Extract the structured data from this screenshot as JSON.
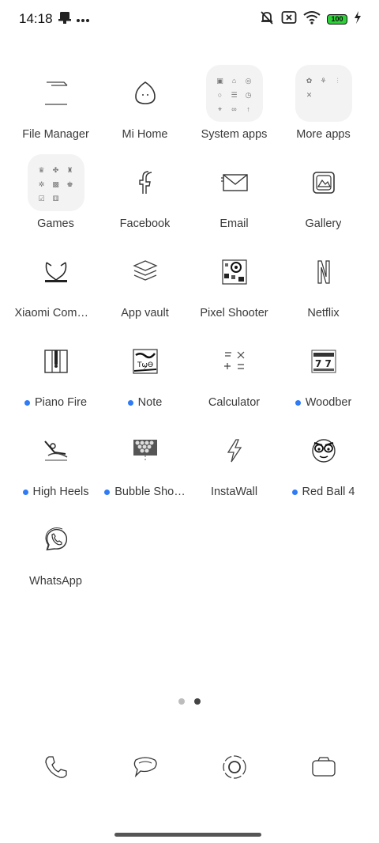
{
  "status_bar": {
    "time": "14:18",
    "battery": "100",
    "left_icons": [
      "notification-icon",
      "more-dots-icon"
    ],
    "right_icons": [
      "mute-icon",
      "no-sim-icon",
      "wifi-icon",
      "battery-icon",
      "charging-icon"
    ]
  },
  "apps": [
    {
      "label": "File Manager",
      "icon": "file-manager-icon",
      "new": false
    },
    {
      "label": "Mi Home",
      "icon": "mi-home-icon",
      "new": false
    },
    {
      "label": "System apps",
      "icon": "folder-icon",
      "new": false
    },
    {
      "label": "More apps",
      "icon": "folder-icon",
      "new": false
    },
    {
      "label": "Games",
      "icon": "folder-icon",
      "new": false
    },
    {
      "label": "Facebook",
      "icon": "facebook-icon",
      "new": false
    },
    {
      "label": "Email",
      "icon": "email-icon",
      "new": false
    },
    {
      "label": "Gallery",
      "icon": "gallery-icon",
      "new": false
    },
    {
      "label": "Xiaomi Comm…",
      "icon": "xiaomi-community-icon",
      "new": false
    },
    {
      "label": "App vault",
      "icon": "app-vault-icon",
      "new": false
    },
    {
      "label": "Pixel Shooter",
      "icon": "pixel-shooter-icon",
      "new": false
    },
    {
      "label": "Netflix",
      "icon": "netflix-icon",
      "new": false
    },
    {
      "label": "Piano Fire",
      "icon": "piano-fire-icon",
      "new": true
    },
    {
      "label": "Note",
      "icon": "note-icon",
      "new": true
    },
    {
      "label": "Calculator",
      "icon": "calculator-icon",
      "new": false
    },
    {
      "label": "Woodber",
      "icon": "woodber-icon",
      "new": true
    },
    {
      "label": "High Heels",
      "icon": "high-heels-icon",
      "new": true
    },
    {
      "label": "Bubble Sho…",
      "icon": "bubble-shooter-icon",
      "new": true
    },
    {
      "label": "InstaWall",
      "icon": "instawall-icon",
      "new": false
    },
    {
      "label": "Red Ball 4",
      "icon": "red-ball-icon",
      "new": true
    },
    {
      "label": "WhatsApp",
      "icon": "whatsapp-icon",
      "new": false
    }
  ],
  "page_indicator": {
    "count": 2,
    "active": 2
  },
  "dock": [
    {
      "name": "phone",
      "icon": "phone-icon"
    },
    {
      "name": "messages",
      "icon": "messages-icon"
    },
    {
      "name": "browser",
      "icon": "browser-icon"
    },
    {
      "name": "camera",
      "icon": "camera-icon"
    }
  ],
  "colors": {
    "new_dot": "#2f7bf5",
    "battery_fill": "#2fd13a",
    "background": "#ffffff"
  }
}
